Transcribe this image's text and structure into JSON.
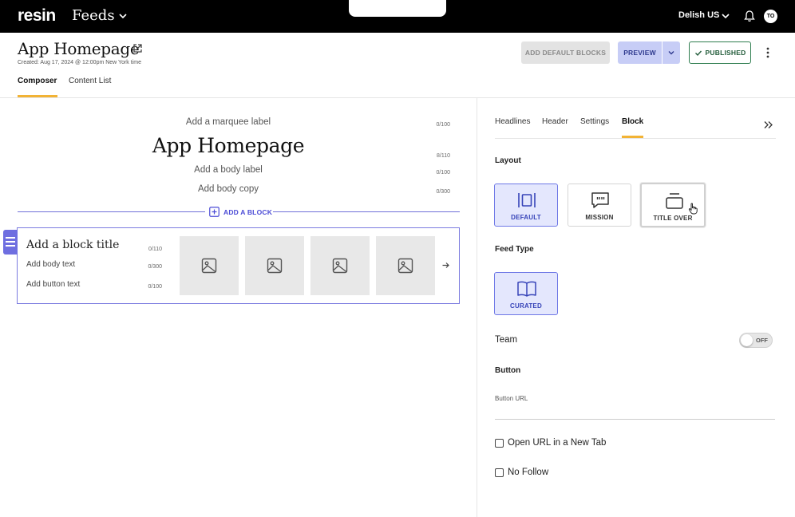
{
  "topbar": {
    "brand": "resin",
    "product": "Feeds",
    "site": "Delish US",
    "avatar_initials": "TO",
    "icons": [
      "chevron-down-icon",
      "bell-icon"
    ]
  },
  "page": {
    "title": "App Homepage",
    "created": "Created: Aug 17, 2024 @ 12:00pm New York time",
    "buttons": {
      "add_default_blocks": "ADD DEFAULT BLOCKS",
      "preview": "PREVIEW",
      "published": "PUBLISHED"
    },
    "tabs": [
      {
        "label": "Composer",
        "active": true
      },
      {
        "label": "Content List",
        "active": false
      }
    ]
  },
  "composer": {
    "marquee_placeholder": "Add a marquee label",
    "marquee_count": "0/100",
    "title": "App Homepage",
    "title_count": "8/110",
    "body_label_placeholder": "Add a body label",
    "body_label_count": "0/100",
    "body_copy_placeholder": "Add body copy",
    "body_copy_count": "0/300",
    "add_block_label": "ADD A BLOCK",
    "block": {
      "title_placeholder": "Add a block title",
      "title_count": "0/110",
      "body_placeholder": "Add body text",
      "body_count": "0/300",
      "button_placeholder": "Add button text",
      "button_count": "0/100"
    }
  },
  "panel": {
    "tabs": [
      {
        "label": "Headlines",
        "active": false
      },
      {
        "label": "Header",
        "active": false
      },
      {
        "label": "Settings",
        "active": false
      },
      {
        "label": "Block",
        "active": true
      }
    ],
    "layout": {
      "label": "Layout",
      "options": [
        {
          "label": "DEFAULT",
          "selected": true
        },
        {
          "label": "MISSION",
          "selected": false
        },
        {
          "label": "TITLE OVER",
          "selected": false
        }
      ]
    },
    "feed_type": {
      "label": "Feed Type",
      "options": [
        {
          "label": "CURATED",
          "selected": true
        }
      ]
    },
    "team": {
      "label": "Team",
      "toggle": "OFF"
    },
    "button": {
      "label": "Button",
      "url_label": "Button URL"
    },
    "checkboxes": [
      {
        "label": "Open URL in a New Tab",
        "checked": false
      },
      {
        "label": "No Follow",
        "checked": false
      }
    ]
  },
  "colors": {
    "accent": "#f2b335",
    "primary": "#4b4bd6",
    "published": "#2e7d4f"
  }
}
